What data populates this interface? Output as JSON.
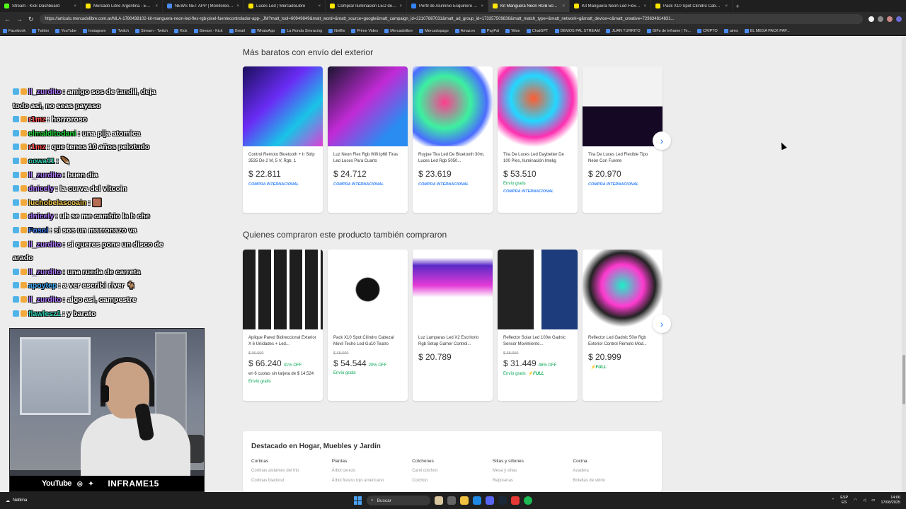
{
  "browser": {
    "tabs": [
      {
        "label": "Stream - Kick Dashboard",
        "color": "#53fc18"
      },
      {
        "label": "Mercado Libre Argentina - Envío",
        "color": "#ffe600"
      },
      {
        "label": "NEWS NET APP | Monitoreo de m",
        "color": "#4b8cf0"
      },
      {
        "label": "Luces Led | MercadoLibre",
        "color": "#ffe600"
      },
      {
        "label": "Comprar Iluminación LED de Inte",
        "color": "#ffe600"
      },
      {
        "label": "Perfil de Aluminio Esquinero De A",
        "color": "#3483fa"
      },
      {
        "label": "Kit Manguera Neon RGB 5050 Le",
        "color": "#ffe600",
        "active": true
      },
      {
        "label": "Kit Manguera Neon Led Flex Rgb",
        "color": "#ffe600"
      },
      {
        "label": "Pack X10 Spot Cilindro Cabezal M",
        "color": "#ffe600"
      }
    ],
    "url": "https://articulo.mercadolibre.com.ar/MLA-1780438102-kit-manguera-neon-led-flex-rgb-pixel-fuentecontrolador-app-_JM?matt_tool=60949849&matt_word=&matt_source=google&matt_campaign_id=22107887031&matt_ad_group_id=173357509836&matt_match_type=&matt_network=g&matt_device=c&matt_creative=729634814831...",
    "bookmarks": [
      "Facebook",
      "Twitter",
      "YouTube",
      "Instagram",
      "Twitch",
      "Stream - Twitch",
      "Kick",
      "Stream - Kick",
      "Gmail",
      "WhatsApp",
      "La Ronda Simracing",
      "Netflix",
      "Prime Video",
      "Mercadolibre",
      "Mercadopago",
      "Amazon",
      "PayPal",
      "Wise",
      "ChatGPT",
      "DEMOS PAL STREAM",
      "JUAN TURRITO",
      "GIFs de Inframe | Te...",
      "CRIPTO",
      "aires",
      "EL MEGA PACK PAP..."
    ]
  },
  "section1": {
    "title": "Más baratos con envío del exterior",
    "products": [
      {
        "title": "Control Remoto Bluetooth + Ir Strip 3535 De 2 M, 5 V, Rgb, 1",
        "orig": "",
        "price": "$ 22.811",
        "discount": "",
        "installments": "",
        "shipping": "",
        "international": "COMPRA INTERNACIONAL",
        "full": ""
      },
      {
        "title": "Luz Neon Flex Rgb Wifi Ip68 Tiras Led Luces Para Cuarto",
        "orig": "",
        "price": "$ 24.712",
        "discount": "",
        "installments": "",
        "shipping": "",
        "international": "COMPRA INTERNACIONAL",
        "full": ""
      },
      {
        "title": "Ruyjue Tira Led De Bluetooth 30m, Luces Led Rgb 5050...",
        "orig": "",
        "price": "$ 23.619",
        "discount": "",
        "installments": "",
        "shipping": "",
        "international": "COMPRA INTERNACIONAL",
        "full": ""
      },
      {
        "title": "Tira De Luces Led Daybetter De 100 Pies, Iluminación Intelig",
        "orig": "",
        "price": "$ 53.510",
        "discount": "",
        "installments": "",
        "shipping": "Envío gratis",
        "international": "COMPRA INTERNACIONAL",
        "full": ""
      },
      {
        "title": "Tira De Luces Led Flexible Tipo Neón Con Fuente",
        "orig": "",
        "price": "$ 20.970",
        "discount": "",
        "installments": "",
        "shipping": "",
        "international": "COMPRA INTERNACIONAL",
        "full": ""
      }
    ]
  },
  "section2": {
    "title": "Quienes compraron este producto también compraron",
    "products": [
      {
        "title": "Aplique Pared Bidireccional Exterior X 6 Unidades + Led...",
        "orig": "$ 96.000",
        "price": "$ 66.240",
        "discount": "31% OFF",
        "installments": "en 6 cuotas sin tarjeta de $ 14.524",
        "shipping": "Envío gratis",
        "international": "",
        "full": ""
      },
      {
        "title": "Pack X10 Spot Cilindro Cabezal Movil Techo Led Gu10 Teatro",
        "orig": "$ 68.000",
        "price": "$ 54.544",
        "discount": "20% OFF",
        "installments": "",
        "shipping": "Envío gratis",
        "international": "",
        "full": ""
      },
      {
        "title": "Luz Lamparas Led X2 Escritorio Rgb Setup Gamer Control...",
        "orig": "",
        "price": "$ 20.789",
        "discount": "",
        "installments": "",
        "shipping": "",
        "international": "",
        "full": ""
      },
      {
        "title": "Reflector Solar Led 100w Gadnic Sensor Movimiento...",
        "orig": "$ 58.900",
        "price": "$ 31.449",
        "discount": "46% OFF",
        "installments": "",
        "shipping": "Envío gratis",
        "international": "",
        "full": "FULL"
      },
      {
        "title": "Reflector Led Gadnic 50w Rgb Exterior Control Remoto Mod...",
        "orig": "",
        "price": "$ 20.999",
        "discount": "",
        "installments": "",
        "shipping": "",
        "international": "",
        "full": "FULL"
      }
    ]
  },
  "chat": [
    {
      "user": "ll_zurdito",
      "color": "#b07cff",
      "text": ": amigo sos de tandil, deja todo asi, no seas payaso"
    },
    {
      "user": "r1mz",
      "color": "#ff4d4d",
      "text": ": horroroso"
    },
    {
      "user": "elmalditodani",
      "color": "#22d33a",
      "text": ": una pija atomica"
    },
    {
      "user": "r1mz",
      "color": "#ff4d4d",
      "text": ": que tenes 10 años pelotudo"
    },
    {
      "user": "cowa11",
      "color": "#2fd3b4",
      "text": ": 🪶"
    },
    {
      "user": "ll_zurdito",
      "color": "#b07cff",
      "text": ": buen dia"
    },
    {
      "user": "dnicely",
      "color": "#b07cff",
      "text": ": la curva del vitcoin"
    },
    {
      "user": "luchobelascoain",
      "color": "#f2c94c",
      "text": ": 🟫"
    },
    {
      "user": "dnicely",
      "color": "#b07cff",
      "text": ": uh se me cambio la b che"
    },
    {
      "user": "Fosol",
      "color": "#3f7fff",
      "text": ": si sos un marronazo va"
    },
    {
      "user": "ll_zurdito",
      "color": "#b07cff",
      "text": ": si queres pone un disco de arado"
    },
    {
      "user": "ll_zurdito",
      "color": "#b07cff",
      "text": ": una rueda de carreta"
    },
    {
      "user": "apoytep",
      "color": "#3fa9f5",
      "text": ": a ver escribi river 🐐"
    },
    {
      "user": "ll_zurdito",
      "color": "#b07cff",
      "text": ": algo asi, campestre"
    },
    {
      "user": "flawlesz1",
      "color": "#2fd3b4",
      "text": ": y barato"
    }
  ],
  "webcam": {
    "youtube": "YouTube",
    "name": "INFRAME15"
  },
  "destacado": {
    "title": "Destacado en Hogar, Muebles y Jardín",
    "columns": [
      {
        "head": "Cortinas",
        "items": [
          "Cortinas aislantes del frio",
          "Cortinas blackout"
        ]
      },
      {
        "head": "Plantas",
        "items": [
          "Árbol cerezo",
          "Árbol fresno rojo americano"
        ]
      },
      {
        "head": "Colchones",
        "items": [
          "Cami colchon",
          "Colchon"
        ]
      },
      {
        "head": "Sillas y sillones",
        "items": [
          "Mesa y sillas",
          "Reposeras"
        ]
      },
      {
        "head": "Cocina",
        "items": [
          "Azadera",
          "Botellas de vidrio"
        ]
      }
    ]
  },
  "taskbar": {
    "weather": "Neblina",
    "search": "Buscar",
    "lang": "ESP",
    "region": "ES",
    "time": "14:06",
    "date": "17/08/2025"
  }
}
